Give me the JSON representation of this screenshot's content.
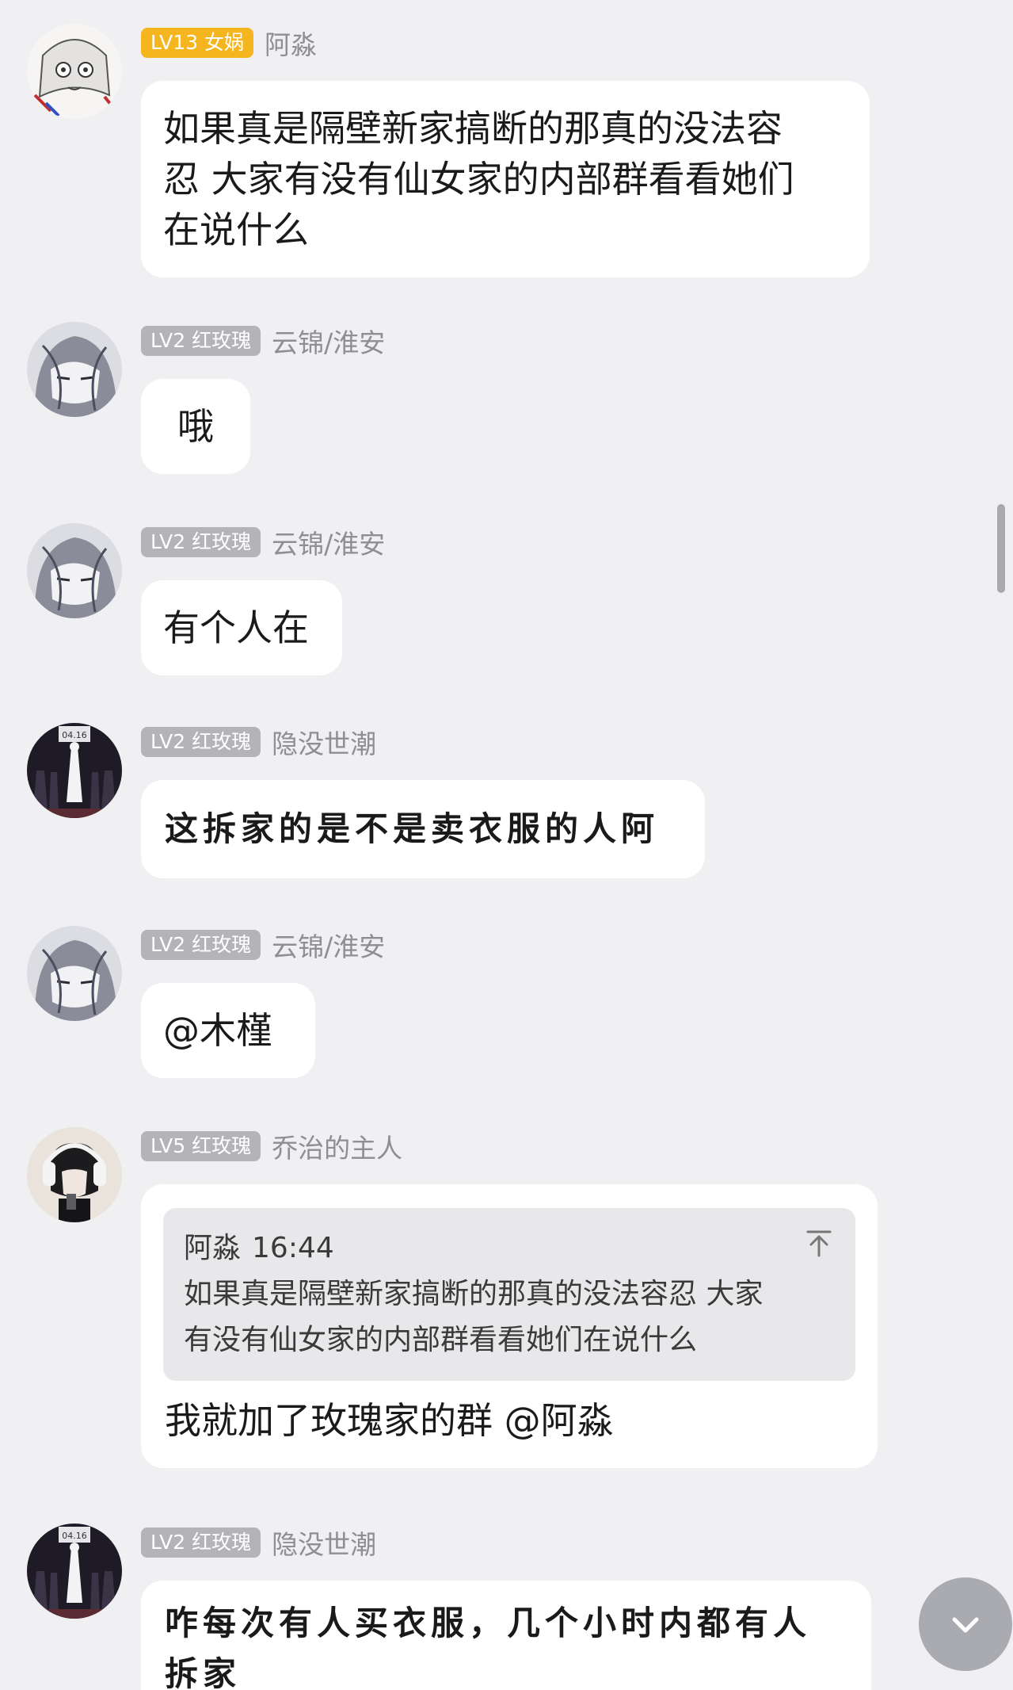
{
  "colors": {
    "background": "#f0f0f3",
    "bubble": "#ffffff",
    "badge_gold": "#f5b51f",
    "badge_grey": "#b3b3b8",
    "nickname": "#8e8e93"
  },
  "messages": [
    {
      "badge": "LV13 女娲",
      "badge_style": "gold",
      "nickname": "阿淼",
      "avatar_icon": "anime-sketch-avatar-icon",
      "text_lines": [
        "如果真是隔壁新家搞断的那真的没法容",
        "忍 大家有没有仙女家的内部群看看她们",
        "在说什么"
      ]
    },
    {
      "badge": "LV2 红玫瑰",
      "badge_style": "grey",
      "nickname": "云锦/淮安",
      "avatar_icon": "anime-grey-hair-avatar-icon",
      "text_lines": [
        "哦"
      ]
    },
    {
      "badge": "LV2 红玫瑰",
      "badge_style": "grey",
      "nickname": "云锦/淮安",
      "avatar_icon": "anime-grey-hair-avatar-icon",
      "text_lines": [
        "有个人在"
      ]
    },
    {
      "badge": "LV2 红玫瑰",
      "badge_style": "grey",
      "nickname": "隐没世潮",
      "avatar_icon": "stage-scene-avatar-icon",
      "avatar_text": "04.16",
      "text_lines": [
        "这拆家的是不是卖衣服的人阿"
      ]
    },
    {
      "badge": "LV2 红玫瑰",
      "badge_style": "grey",
      "nickname": "云锦/淮安",
      "avatar_icon": "anime-grey-hair-avatar-icon",
      "text_lines": [
        "@木槿"
      ]
    },
    {
      "badge": "LV5 红玫瑰",
      "badge_style": "grey",
      "nickname": "乔治的主人",
      "avatar_icon": "headphones-person-avatar-icon",
      "quote": {
        "author": "阿淼",
        "time": "16:44",
        "lines": [
          "如果真是隔壁新家搞断的那真的没法容忍 大家",
          "有没有仙女家的内部群看看她们在说什么"
        ],
        "jump_icon": "jump-to-top-icon"
      },
      "text_lines": [
        "我就加了玫瑰家的群 @阿淼"
      ]
    },
    {
      "badge": "LV2 红玫瑰",
      "badge_style": "grey",
      "nickname": "隐没世潮",
      "avatar_icon": "stage-scene-avatar-icon",
      "avatar_text": "04.16",
      "text_lines": [
        "咋每次有人买衣服，几个小时内都有人",
        "拆家"
      ]
    }
  ],
  "scroll_down_icon": "chevron-down-icon"
}
